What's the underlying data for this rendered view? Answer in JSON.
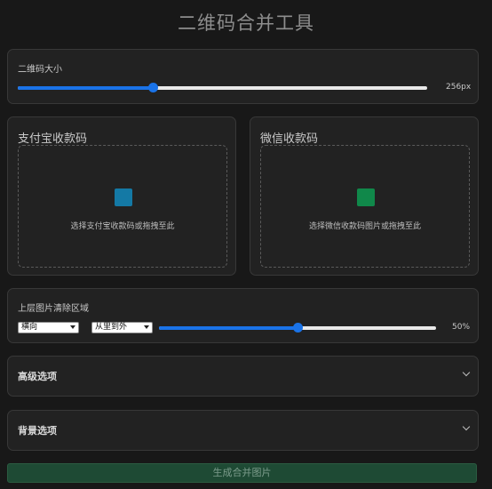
{
  "title": "二维码合并工具",
  "size_section": {
    "label": "二维码大小",
    "value_text": "256px",
    "slider_fraction": 0.33,
    "accent": "#1a73e8"
  },
  "uploads": [
    {
      "title": "支付宝收款码",
      "prompt": "选择支付宝收款码或拖拽至此",
      "icon": "alipay-image-icon",
      "icon_color": "#1479a5"
    },
    {
      "title": "微信收款码",
      "prompt": "选择微信收款码图片或拖拽至此",
      "icon": "wechat-image-icon",
      "icon_color": "#10884a"
    }
  ],
  "clear_section": {
    "label": "上层图片清除区域",
    "direction_selected": "横向",
    "mode_selected": "从里到外",
    "value_text": "50%",
    "slider_fraction": 0.5
  },
  "advanced": {
    "label": "高级选项"
  },
  "background": {
    "label": "背景选项"
  },
  "generate_button": {
    "label": "生成合并图片",
    "color": "#1e4a34"
  }
}
